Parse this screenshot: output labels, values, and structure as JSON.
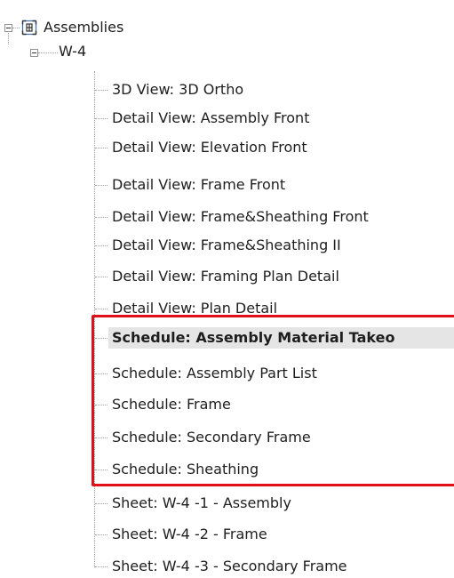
{
  "tree": {
    "root": {
      "label": "Assemblies",
      "icon": "assembly-icon",
      "expanded": true
    },
    "assembly": {
      "label": "W-4",
      "expanded": true
    },
    "items": [
      {
        "label": "3D View: 3D Ortho"
      },
      {
        "label": "Detail View: Assembly Front"
      },
      {
        "label": "Detail View: Elevation Front"
      },
      {
        "label": "Detail View: Frame Front"
      },
      {
        "label": "Detail View: Frame&Sheathing Front"
      },
      {
        "label": "Detail View: Frame&Sheathing II"
      },
      {
        "label": "Detail View: Framing Plan Detail"
      },
      {
        "label": "Detail View: Plan Detail"
      },
      {
        "label": "Schedule: Assembly Material Takeo",
        "selected": true
      },
      {
        "label": "Schedule: Assembly Part List"
      },
      {
        "label": "Schedule: Frame"
      },
      {
        "label": "Schedule: Secondary Frame"
      },
      {
        "label": "Schedule: Sheathing"
      },
      {
        "label": "Sheet: W-4 -1 - Assembly"
      },
      {
        "label": "Sheet: W-4 -2 - Frame"
      },
      {
        "label": "Sheet: W-4 -3 - Secondary Frame"
      }
    ]
  },
  "colors": {
    "highlight_border": "#e0101a",
    "selected_background": "#e5e5e5",
    "connector": "#a0a0a0"
  }
}
